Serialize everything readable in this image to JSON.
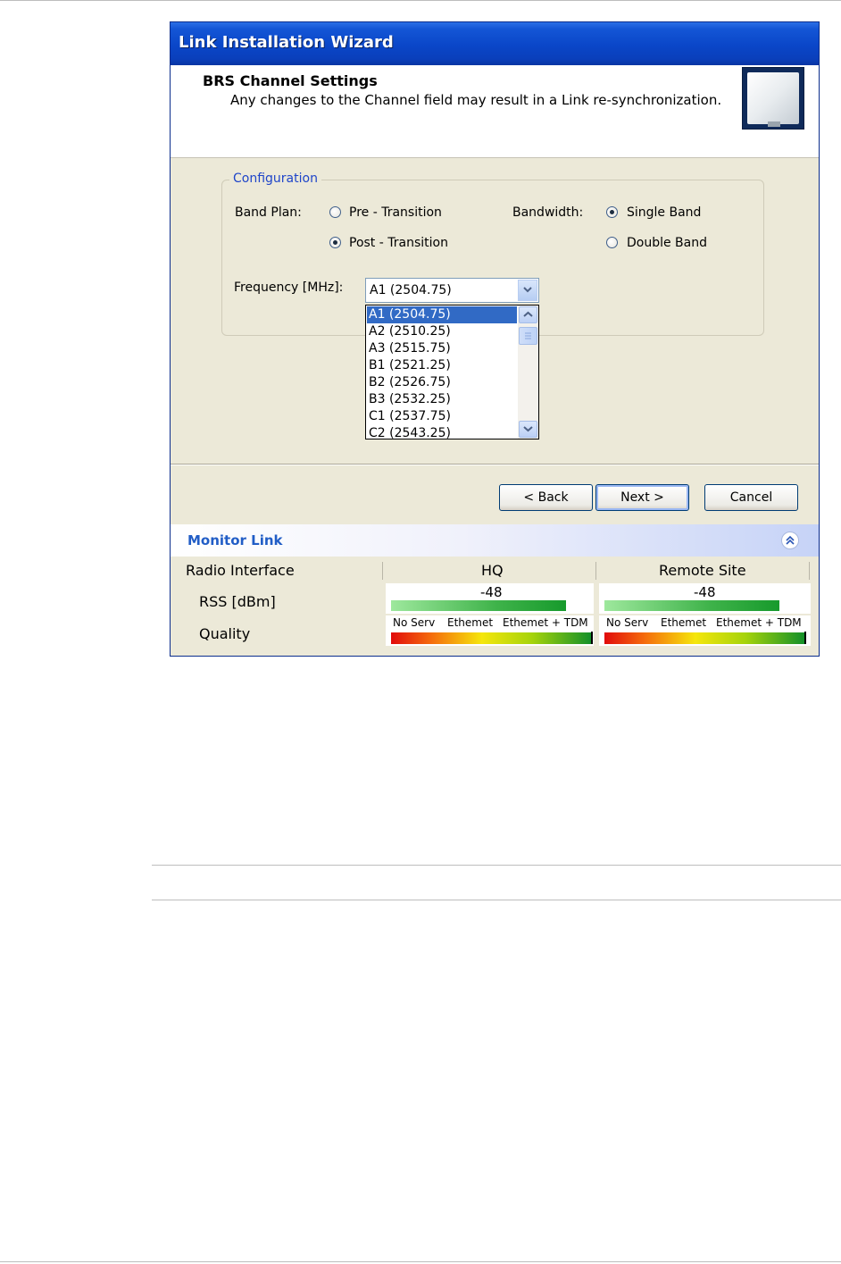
{
  "window": {
    "title": "Link Installation Wizard"
  },
  "header": {
    "title": "BRS Channel Settings",
    "subtitle": "Any changes to the Channel field may result in a Link re-synchronization.",
    "logo_icon": "radio-panel-icon"
  },
  "config": {
    "legend": "Configuration",
    "band_plan_label": "Band Plan:",
    "band_plan_options": [
      {
        "label": "Pre - Transition",
        "checked": false
      },
      {
        "label": "Post - Transition",
        "checked": true
      }
    ],
    "bandwidth_label": "Bandwidth:",
    "bandwidth_options": [
      {
        "label": "Single Band",
        "checked": true
      },
      {
        "label": "Double Band",
        "checked": false
      }
    ],
    "frequency_label": "Frequency [MHz]:",
    "frequency_value": "A1 (2504.75)",
    "frequency_options": [
      "A1 (2504.75)",
      "A2 (2510.25)",
      "A3 (2515.75)",
      "B1 (2521.25)",
      "B2 (2526.75)",
      "B3 (2532.25)",
      "C1 (2537.75)",
      "C2 (2543.25)"
    ],
    "frequency_selected_index": 0
  },
  "buttons": {
    "back": "< Back",
    "next": "Next >",
    "cancel": "Cancel"
  },
  "monitor": {
    "title": "Monitor Link",
    "collapse_icon": "double-chevron-up-icon",
    "col_interface": "Radio Interface",
    "col_hq": "HQ",
    "col_remote": "Remote Site",
    "row_rss": "RSS [dBm]",
    "row_quality": "Quality",
    "hq_rss": "-48",
    "remote_rss": "-48",
    "quality_scale": [
      "No Serv",
      "Ethemet",
      "Ethemet + TDM"
    ]
  },
  "colors": {
    "title_bar": "#0a46c8",
    "selection": "#316ac5",
    "legend_text": "#1f45c9",
    "monitor_title": "#215dc6"
  }
}
